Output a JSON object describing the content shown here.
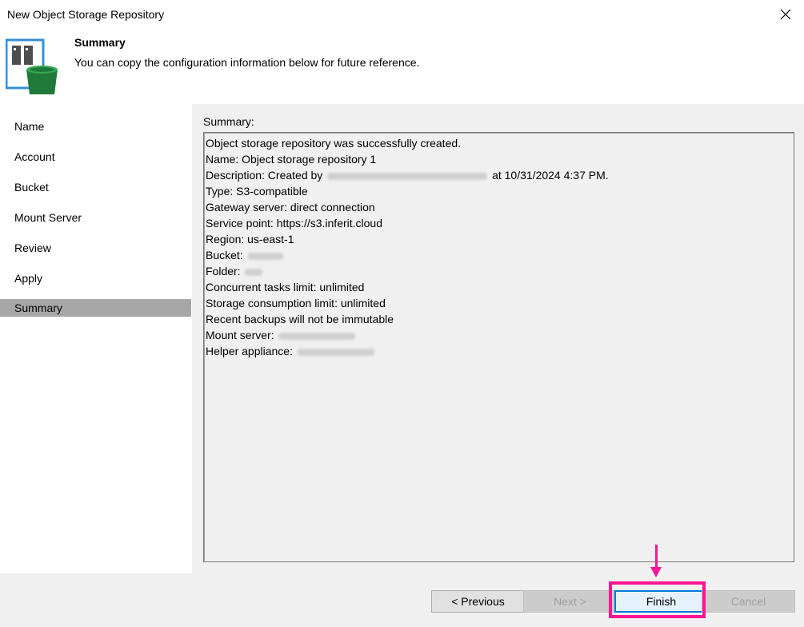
{
  "window": {
    "title": "New Object Storage Repository"
  },
  "header": {
    "title": "Summary",
    "description": "You can copy the configuration information below for future reference."
  },
  "sidebar": {
    "items": [
      {
        "label": "Name"
      },
      {
        "label": "Account"
      },
      {
        "label": "Bucket"
      },
      {
        "label": "Mount Server"
      },
      {
        "label": "Review"
      },
      {
        "label": "Apply"
      },
      {
        "label": "Summary",
        "active": true
      }
    ]
  },
  "summary": {
    "label": "Summary:",
    "lines": {
      "created": "Object storage repository was successfully created.",
      "name": "Name: Object storage repository 1",
      "description_prefix": "Description: Created by",
      "description_suffix": "at 10/31/2024 4:37 PM.",
      "type": "Type: S3-compatible",
      "gateway": "Gateway server: direct connection",
      "service_point": "Service point: https://s3.inferit.cloud",
      "region": "Region: us-east-1",
      "bucket": "Bucket:",
      "folder": "Folder:",
      "tasks": "Concurrent tasks limit: unlimited",
      "storage": "Storage consumption limit: unlimited",
      "immutable": "Recent backups will not be immutable",
      "mount_server": "Mount server:",
      "helper": "Helper appliance:"
    }
  },
  "footer": {
    "previous": "< Previous",
    "next": "Next >",
    "finish": "Finish",
    "cancel": "Cancel"
  },
  "colors": {
    "highlight": "#ff1493",
    "active_sidebar": "#a7a7a7",
    "focus_border": "#0078d7",
    "icon_blue": "#3a8fd0",
    "icon_green": "#1f7a3a"
  }
}
